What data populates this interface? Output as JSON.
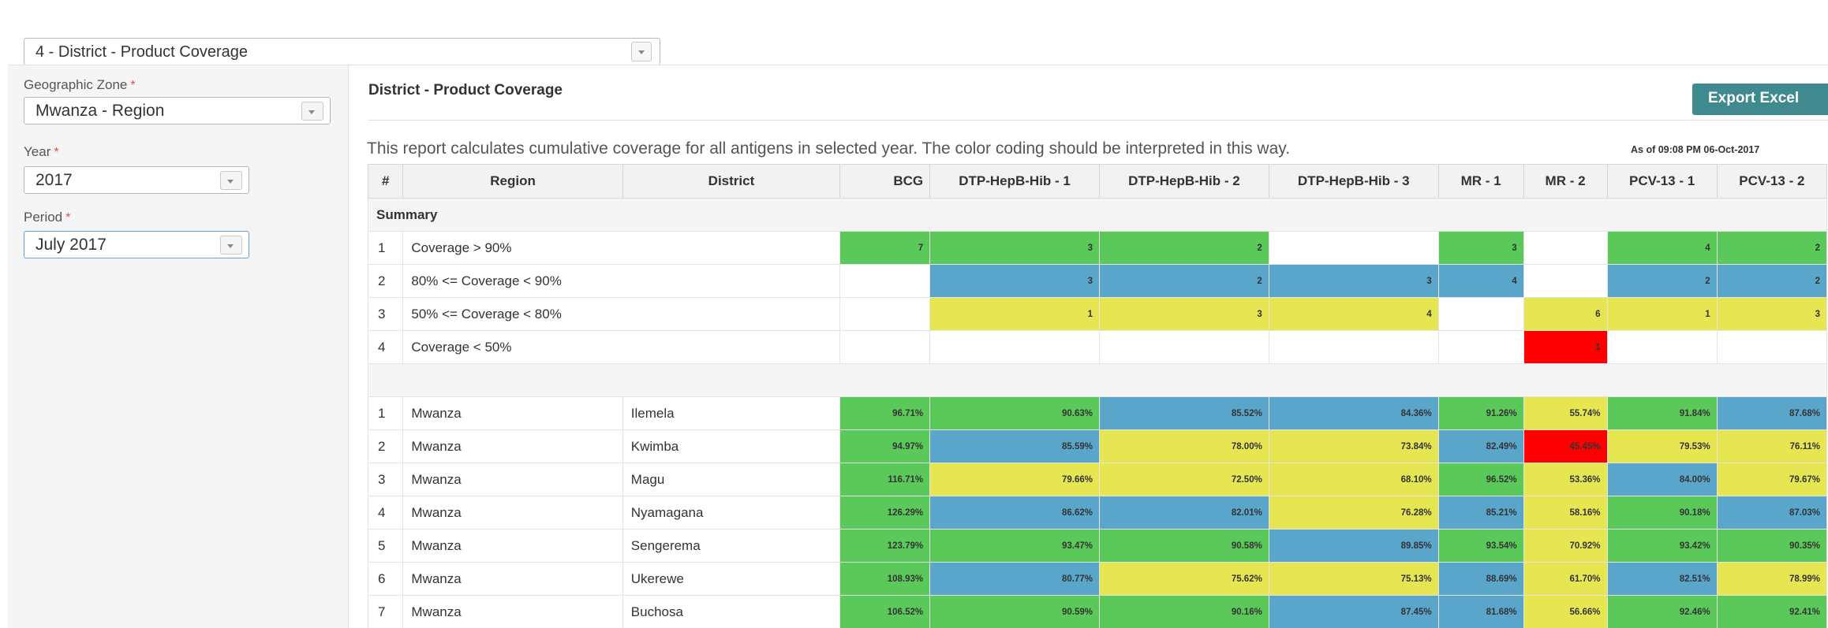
{
  "report_select": {
    "value": "4 - District - Product Coverage"
  },
  "filters": {
    "zone_label": "Geographic Zone",
    "zone_value": "Mwanza - Region",
    "year_label": "Year",
    "year_value": "2017",
    "period_label": "Period",
    "period_value": "July 2017",
    "required_mark": "*"
  },
  "report": {
    "title": "District - Product Coverage",
    "export_label": "Export Excel",
    "description": "This report calculates cumulative coverage for all antigens in selected year. The color coding should be interpreted in this way.",
    "as_of": "As of 09:08 PM 06-Oct-2017"
  },
  "colors": {
    "green": "#5bc85a",
    "blue": "#5aa6cb",
    "yellow": "#e6e653",
    "red": "#ff0000"
  },
  "table": {
    "headers": [
      "#",
      "Region",
      "District",
      "BCG",
      "DTP-HepB-Hib - 1",
      "DTP-HepB-Hib - 2",
      "DTP-HepB-Hib - 3",
      "MR - 1",
      "MR - 2",
      "PCV-13 - 1",
      "PCV-13 - 2"
    ],
    "summary_label": "Summary",
    "summary_rows": [
      {
        "idx": "1",
        "label": "Coverage > 90%",
        "cells": [
          {
            "v": "7",
            "c": "green"
          },
          {
            "v": "3",
            "c": "green"
          },
          {
            "v": "2",
            "c": "green"
          },
          {
            "v": "",
            "c": ""
          },
          {
            "v": "3",
            "c": "green"
          },
          {
            "v": "",
            "c": ""
          },
          {
            "v": "4",
            "c": "green"
          },
          {
            "v": "2",
            "c": "green"
          }
        ]
      },
      {
        "idx": "2",
        "label": "80% <= Coverage < 90%",
        "cells": [
          {
            "v": "",
            "c": ""
          },
          {
            "v": "3",
            "c": "blue"
          },
          {
            "v": "2",
            "c": "blue"
          },
          {
            "v": "3",
            "c": "blue"
          },
          {
            "v": "4",
            "c": "blue"
          },
          {
            "v": "",
            "c": ""
          },
          {
            "v": "2",
            "c": "blue"
          },
          {
            "v": "2",
            "c": "blue"
          }
        ]
      },
      {
        "idx": "3",
        "label": "50% <= Coverage < 80%",
        "cells": [
          {
            "v": "",
            "c": ""
          },
          {
            "v": "1",
            "c": "yellow"
          },
          {
            "v": "3",
            "c": "yellow"
          },
          {
            "v": "4",
            "c": "yellow"
          },
          {
            "v": "",
            "c": ""
          },
          {
            "v": "6",
            "c": "yellow"
          },
          {
            "v": "1",
            "c": "yellow"
          },
          {
            "v": "3",
            "c": "yellow"
          }
        ]
      },
      {
        "idx": "4",
        "label": "Coverage < 50%",
        "cells": [
          {
            "v": "",
            "c": ""
          },
          {
            "v": "",
            "c": ""
          },
          {
            "v": "",
            "c": ""
          },
          {
            "v": "",
            "c": ""
          },
          {
            "v": "",
            "c": ""
          },
          {
            "v": "1",
            "c": "red"
          },
          {
            "v": "",
            "c": ""
          },
          {
            "v": "",
            "c": ""
          }
        ]
      }
    ],
    "rows": [
      {
        "idx": "1",
        "region": "Mwanza",
        "district": "Ilemela",
        "cells": [
          {
            "v": "96.71%",
            "c": "green"
          },
          {
            "v": "90.63%",
            "c": "green"
          },
          {
            "v": "85.52%",
            "c": "blue"
          },
          {
            "v": "84.36%",
            "c": "blue"
          },
          {
            "v": "91.26%",
            "c": "green"
          },
          {
            "v": "55.74%",
            "c": "yellow"
          },
          {
            "v": "91.84%",
            "c": "green"
          },
          {
            "v": "87.68%",
            "c": "blue"
          }
        ]
      },
      {
        "idx": "2",
        "region": "Mwanza",
        "district": "Kwimba",
        "cells": [
          {
            "v": "94.97%",
            "c": "green"
          },
          {
            "v": "85.59%",
            "c": "blue"
          },
          {
            "v": "78.00%",
            "c": "yellow"
          },
          {
            "v": "73.84%",
            "c": "yellow"
          },
          {
            "v": "82.49%",
            "c": "blue"
          },
          {
            "v": "45.45%",
            "c": "red"
          },
          {
            "v": "79.53%",
            "c": "yellow"
          },
          {
            "v": "76.11%",
            "c": "yellow"
          }
        ]
      },
      {
        "idx": "3",
        "region": "Mwanza",
        "district": "Magu",
        "cells": [
          {
            "v": "116.71%",
            "c": "green"
          },
          {
            "v": "79.66%",
            "c": "yellow"
          },
          {
            "v": "72.50%",
            "c": "yellow"
          },
          {
            "v": "68.10%",
            "c": "yellow"
          },
          {
            "v": "96.52%",
            "c": "green"
          },
          {
            "v": "53.36%",
            "c": "yellow"
          },
          {
            "v": "84.00%",
            "c": "blue"
          },
          {
            "v": "79.67%",
            "c": "yellow"
          }
        ]
      },
      {
        "idx": "4",
        "region": "Mwanza",
        "district": "Nyamagana",
        "cells": [
          {
            "v": "126.29%",
            "c": "green"
          },
          {
            "v": "86.62%",
            "c": "blue"
          },
          {
            "v": "82.01%",
            "c": "blue"
          },
          {
            "v": "76.28%",
            "c": "yellow"
          },
          {
            "v": "85.21%",
            "c": "blue"
          },
          {
            "v": "58.16%",
            "c": "yellow"
          },
          {
            "v": "90.18%",
            "c": "green"
          },
          {
            "v": "87.03%",
            "c": "blue"
          }
        ]
      },
      {
        "idx": "5",
        "region": "Mwanza",
        "district": "Sengerema",
        "cells": [
          {
            "v": "123.79%",
            "c": "green"
          },
          {
            "v": "93.47%",
            "c": "green"
          },
          {
            "v": "90.58%",
            "c": "green"
          },
          {
            "v": "89.85%",
            "c": "blue"
          },
          {
            "v": "93.54%",
            "c": "green"
          },
          {
            "v": "70.92%",
            "c": "yellow"
          },
          {
            "v": "93.42%",
            "c": "green"
          },
          {
            "v": "90.35%",
            "c": "green"
          }
        ]
      },
      {
        "idx": "6",
        "region": "Mwanza",
        "district": "Ukerewe",
        "cells": [
          {
            "v": "108.93%",
            "c": "green"
          },
          {
            "v": "80.77%",
            "c": "blue"
          },
          {
            "v": "75.62%",
            "c": "yellow"
          },
          {
            "v": "75.13%",
            "c": "yellow"
          },
          {
            "v": "88.69%",
            "c": "blue"
          },
          {
            "v": "61.70%",
            "c": "yellow"
          },
          {
            "v": "82.51%",
            "c": "blue"
          },
          {
            "v": "78.99%",
            "c": "yellow"
          }
        ]
      },
      {
        "idx": "7",
        "region": "Mwanza",
        "district": "Buchosa",
        "cells": [
          {
            "v": "106.52%",
            "c": "green"
          },
          {
            "v": "90.59%",
            "c": "green"
          },
          {
            "v": "90.16%",
            "c": "green"
          },
          {
            "v": "87.45%",
            "c": "blue"
          },
          {
            "v": "81.68%",
            "c": "blue"
          },
          {
            "v": "56.66%",
            "c": "yellow"
          },
          {
            "v": "92.46%",
            "c": "green"
          },
          {
            "v": "92.41%",
            "c": "green"
          }
        ]
      }
    ]
  }
}
